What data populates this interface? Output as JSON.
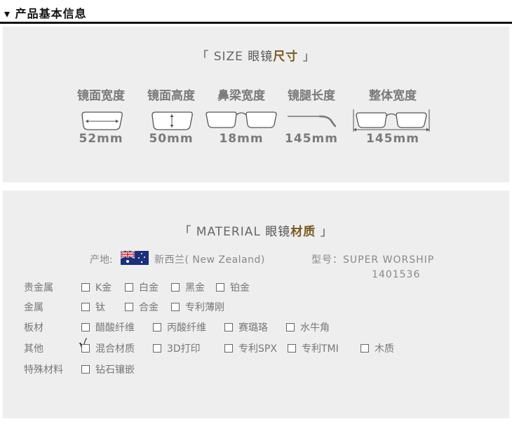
{
  "header": {
    "title": "▾ 产品基本信息"
  },
  "size_section": {
    "title_open": "「 ",
    "title_en": "SIZE",
    "title_cn": " 眼镜",
    "title_hl": "尺寸",
    "title_close": " 」",
    "dimensions": [
      {
        "label": "镜面宽度",
        "value": "52mm",
        "icon": "lens-width-icon"
      },
      {
        "label": "镜面高度",
        "value": "50mm",
        "icon": "lens-height-icon"
      },
      {
        "label": "鼻梁宽度",
        "value": "18mm",
        "icon": "bridge-width-icon"
      },
      {
        "label": "镜腿长度",
        "value": "145mm",
        "icon": "temple-length-icon"
      },
      {
        "label": "整体宽度",
        "value": "145mm",
        "icon": "total-width-icon"
      }
    ]
  },
  "material_section": {
    "title_open": "「 ",
    "title_en": "MATERIAL",
    "title_cn": " 眼镜",
    "title_hl": "材质",
    "title_close": " 」",
    "origin_label": "产地:",
    "origin_value": "新西兰( New Zealand)",
    "model_label": "型号：SUPER  WORSHIP",
    "model_value": "1401536",
    "rows": [
      {
        "label": "贵金属",
        "options": [
          "K金",
          "白金",
          "黑金",
          "铂金"
        ]
      },
      {
        "label": "金属",
        "options": [
          "钛",
          "合金",
          "专利薄刚"
        ]
      },
      {
        "label": "板材",
        "options": [
          "醋酸纤维",
          "丙酸纤维",
          "赛璐珞",
          "水牛角"
        ]
      },
      {
        "label": "其他",
        "options": [
          "混合材质",
          "3D打印",
          "专利SPX",
          "专利TMI",
          "木质"
        ]
      },
      {
        "label": "特殊材料",
        "options": [
          "钻石镶嵌"
        ]
      }
    ],
    "check_mark": "√",
    "checked_option": "混合材质"
  },
  "colors": {
    "accent": "#7a5a24",
    "panel": "#eeeeee",
    "rule": "#111111"
  }
}
